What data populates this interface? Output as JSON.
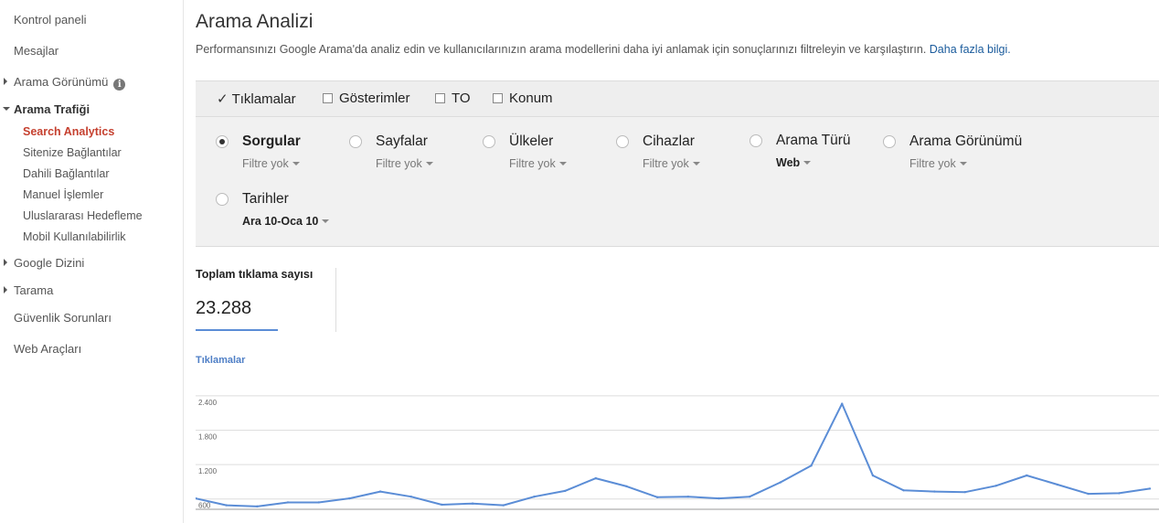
{
  "sidebar": {
    "items": [
      {
        "label": "Kontrol paneli"
      },
      {
        "label": "Mesajlar"
      },
      {
        "label": "Arama Görünümü",
        "info": "i"
      },
      {
        "label": "Arama Trafiği"
      },
      {
        "label": "Search Analytics"
      },
      {
        "label": "Sitenize Bağlantılar"
      },
      {
        "label": "Dahili Bağlantılar"
      },
      {
        "label": "Manuel İşlemler"
      },
      {
        "label": "Uluslararası Hedefleme"
      },
      {
        "label": "Mobil Kullanılabilirlik"
      },
      {
        "label": "Google Dizini"
      },
      {
        "label": "Tarama"
      },
      {
        "label": "Güvenlik Sorunları"
      },
      {
        "label": "Web Araçları"
      }
    ]
  },
  "header": {
    "title": "Arama Analizi",
    "description": "Performansınızı Google Arama'da analiz edin ve kullanıcılarınızın arama modellerini daha iyi anlamak için sonuçlarınızı filtreleyin ve karşılaştırın.",
    "link": "Daha fazla bilgi."
  },
  "metrics": [
    {
      "label": "Tıklamalar",
      "checked": true,
      "mark": "✓"
    },
    {
      "label": "Gösterimler",
      "checked": false
    },
    {
      "label": "TO",
      "checked": false
    },
    {
      "label": "Konum",
      "checked": false
    }
  ],
  "dimensions": [
    {
      "label": "Sorgular",
      "filter": "Filtre yok",
      "selected": true
    },
    {
      "label": "Sayfalar",
      "filter": "Filtre yok",
      "selected": false
    },
    {
      "label": "Ülkeler",
      "filter": "Filtre yok",
      "selected": false
    },
    {
      "label": "Cihazlar",
      "filter": "Filtre yok",
      "selected": false
    },
    {
      "label": "Arama Türü",
      "filter": "Web",
      "selected": false
    },
    {
      "label": "Arama Görünümü",
      "filter": "Filtre yok",
      "selected": false
    },
    {
      "label": "Tarihler",
      "filter": "Ara 10-Oca 10",
      "selected": false
    }
  ],
  "totals": {
    "label": "Toplam tıklama sayısı",
    "value": "23.288"
  },
  "chart_data": {
    "type": "line",
    "title": "",
    "xlabel": "",
    "ylabel": "Tıklamalar",
    "ylim": [
      420,
      2780
    ],
    "yticks": [
      600,
      1200,
      1800,
      2400
    ],
    "ytick_labels": [
      "600",
      "1.200",
      "1.800",
      "2.400"
    ],
    "grid": true,
    "color": "#5b8dd6",
    "series": [
      {
        "values": [
          610,
          490,
          470,
          540,
          540,
          610,
          730,
          640,
          500,
          520,
          490,
          640,
          740,
          960,
          820,
          630,
          640,
          610,
          640,
          890,
          1180,
          2260,
          1010,
          750,
          730,
          720,
          830,
          1010,
          850,
          690,
          700,
          780
        ]
      }
    ]
  }
}
